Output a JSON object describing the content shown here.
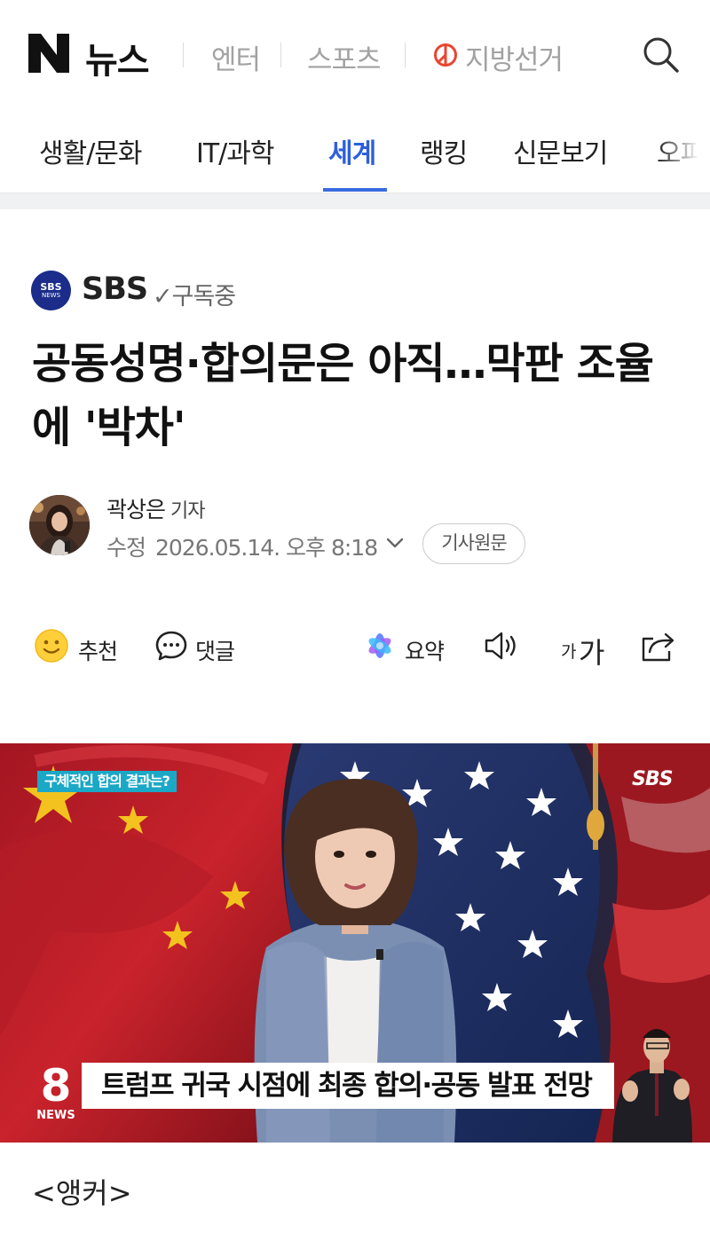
{
  "header": {
    "brand": "뉴스",
    "links": [
      "엔터",
      "스포츠",
      "지방선거"
    ]
  },
  "category_nav": {
    "items": [
      "생활/문화",
      "IT/과학",
      "세계",
      "랭킹",
      "신문보기",
      "오피"
    ],
    "active": "세계"
  },
  "press": {
    "logo_text": "SBS",
    "logo_sub": "NEWS",
    "name": "SBS",
    "subscribed": "✓구독중"
  },
  "article": {
    "headline": "공동성명·합의문은 아직…막판 조율에 '박차'",
    "reporter_name": "곽상은",
    "reporter_role": "기자",
    "modified_label": "수정",
    "modified_time": "2026.05.14. 오후 8:18",
    "original_button": "기사원문",
    "body_start": "<앵커>"
  },
  "actions": {
    "recommend": "추천",
    "comment": "댓글",
    "summary": "요약",
    "font_small": "가",
    "font_large": "가"
  },
  "video": {
    "caption_tag": "구체적인 합의 결과는?",
    "watermark": "SBS",
    "ticker": "트럼프 귀국 시점에 최종 합의·공동 발표 전망",
    "program_number": "8",
    "program_label": "NEWS"
  },
  "colors": {
    "accent": "#2c5fdb",
    "vote_red": "#e8462f",
    "press_navy": "#1b2c8a"
  }
}
